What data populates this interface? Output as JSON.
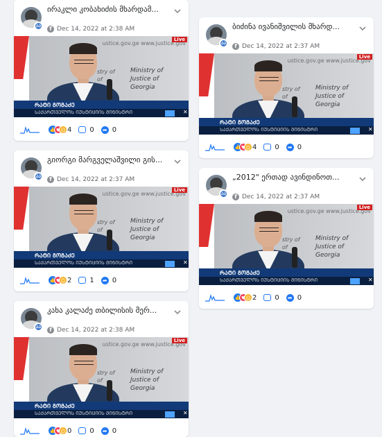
{
  "media": {
    "url_text": "ustice.gov.ge www.justice.gov",
    "ministry_text": "Ministry of\nJustice of\nGeorgia",
    "left_text": "stry of\nof\ngia",
    "live_label": "Live",
    "lower_title": "ᲠᲐᲢᲘ ᲒᲝᲒᲐᲫᲔ",
    "lower_sub": "ᲡᲐᲥᲐᲠᲗᲕᲔᲚᲝᲡ ᲘᲣᲡᲢᲘᲪᲘᲘᲡ ᲛᲘᲜᲘᲡᲢᲠᲘ"
  },
  "posts": [
    {
      "title": "ირაკლი კობახიძის მხარდამ...",
      "date": "Dec 14, 2022 at 2:38 AM",
      "reactions": "4",
      "comments": "0",
      "shares": "0"
    },
    {
      "title": "გიორგი მარგველაშვილი გის...",
      "date": "Dec 14, 2022 at 2:37 AM",
      "reactions": "2",
      "comments": "1",
      "shares": "0"
    },
    {
      "title": "კახა კალაძე თბილისის მერ...",
      "date": "Dec 14, 2022 at 2:38 AM",
      "reactions": "0",
      "comments": "0",
      "shares": "0"
    },
    {
      "title": "ბიძინა ივანიშვილის მხარდ...",
      "date": "Dec 14, 2022 at 2:37 AM",
      "reactions": "4",
      "comments": "0",
      "shares": "0"
    },
    {
      "title": "„2012\" ერთად ავინდინოთ...",
      "date": "Dec 14, 2022 at 2:37 AM",
      "reactions": "2",
      "comments": "0",
      "shares": "0"
    }
  ],
  "colors": {
    "accent": "#2078f4",
    "background": "#f0f2f5"
  }
}
